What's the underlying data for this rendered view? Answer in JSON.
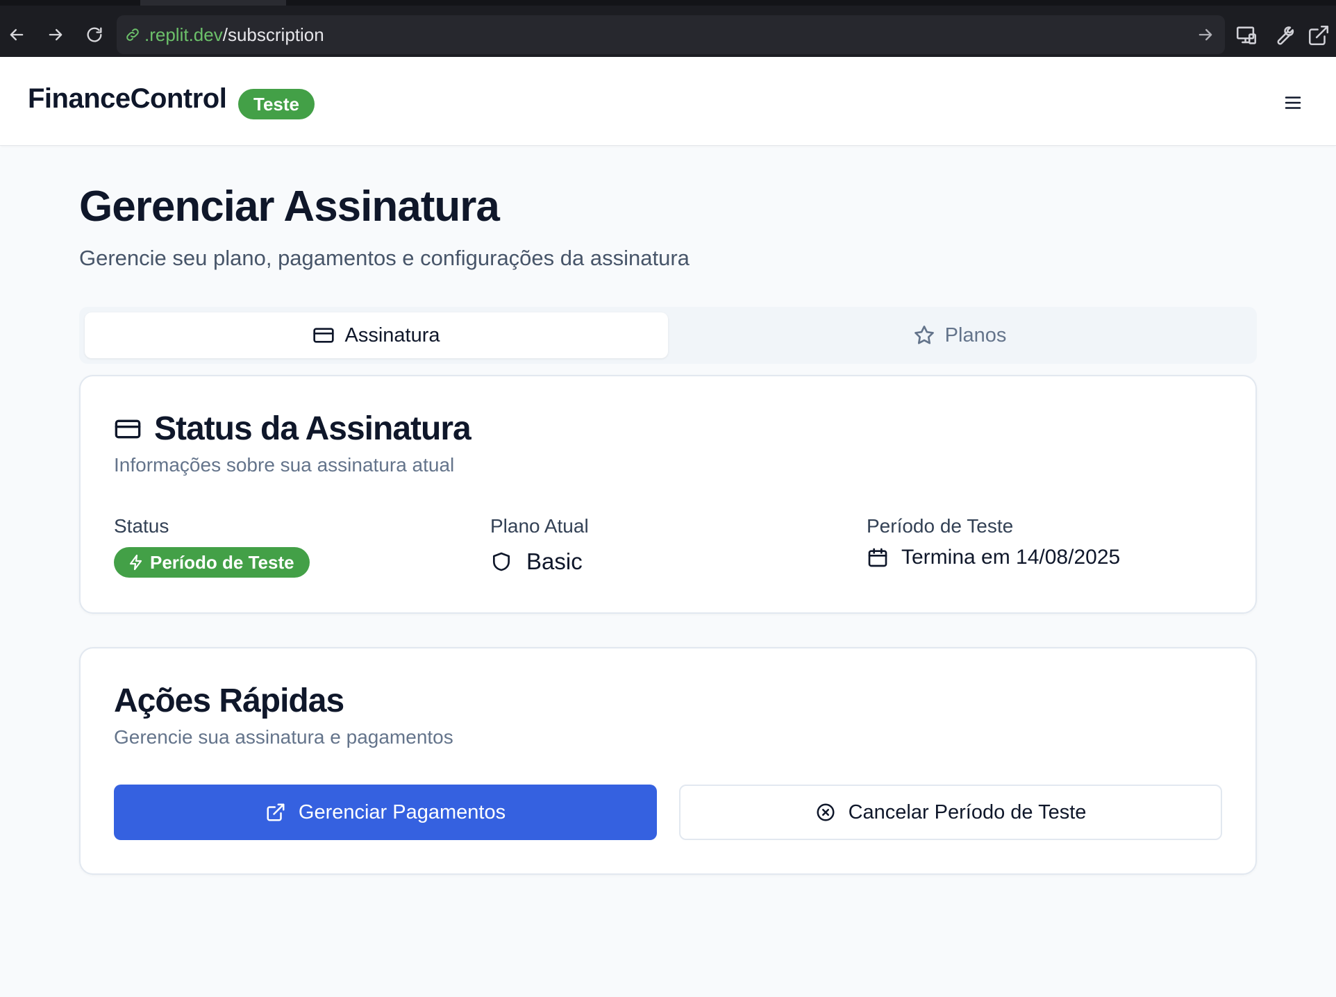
{
  "browser": {
    "url_host": ".replit.dev",
    "url_path": "/subscription"
  },
  "header": {
    "brand": "FinanceControl",
    "badge": "Teste"
  },
  "page": {
    "title": "Gerenciar Assinatura",
    "subtitle": "Gerencie seu plano, pagamentos e configurações da assinatura"
  },
  "tabs": [
    {
      "label": "Assinatura",
      "icon": "credit-card-icon",
      "active": true
    },
    {
      "label": "Planos",
      "icon": "star-icon",
      "active": false
    }
  ],
  "status_card": {
    "title": "Status da Assinatura",
    "description": "Informações sobre sua assinatura atual",
    "fields": {
      "status_label": "Status",
      "status_value": "Período de Teste",
      "plan_label": "Plano Atual",
      "plan_value": "Basic",
      "trial_label": "Período de Teste",
      "trial_value": "Termina em 14/08/2025"
    }
  },
  "actions_card": {
    "title": "Ações Rápidas",
    "description": "Gerencie sua assinatura e pagamentos",
    "manage_payments_label": "Gerenciar Pagamentos",
    "cancel_trial_label": "Cancelar Período de Teste"
  },
  "colors": {
    "accent_green": "#43a047",
    "primary_blue": "#3561e0",
    "url_green": "#6cc06a"
  }
}
